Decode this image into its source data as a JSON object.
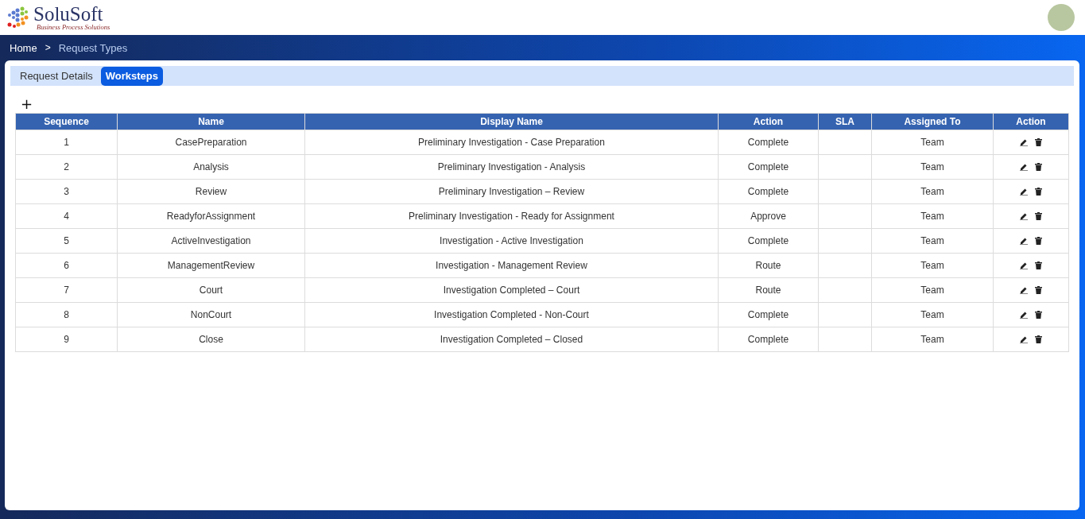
{
  "logo": {
    "name": "SoluSoft",
    "tagline": "Business Process Solutions"
  },
  "breadcrumb": [
    {
      "label": "Home",
      "current": false
    },
    {
      "label": "Request Types",
      "current": true
    }
  ],
  "breadcrumb_separator": ">",
  "tabs": [
    {
      "label": "Request Details",
      "selected": false
    },
    {
      "label": "Worksteps",
      "selected": true
    }
  ],
  "add_button": "+",
  "table": {
    "columns": [
      "Sequence",
      "Name",
      "Display Name",
      "Action",
      "SLA",
      "Assigned To",
      "Action"
    ],
    "rows": [
      {
        "sequence": "1",
        "name": "CasePreparation",
        "display_name": "Preliminary Investigation - Case Preparation",
        "action": "Complete",
        "assigned_to": "Team"
      },
      {
        "sequence": "2",
        "name": "Analysis",
        "display_name": "Preliminary Investigation - Analysis",
        "action": "Complete",
        "assigned_to": "Team"
      },
      {
        "sequence": "3",
        "name": "Review",
        "display_name": "Preliminary Investigation – Review",
        "action": "Complete",
        "assigned_to": "Team"
      },
      {
        "sequence": "4",
        "name": "ReadyforAssignment",
        "display_name": "Preliminary Investigation - Ready for Assignment",
        "action": "Approve",
        "assigned_to": "Team"
      },
      {
        "sequence": "5",
        "name": "ActiveInvestigation",
        "display_name": "Investigation - Active Investigation",
        "action": "Complete",
        "assigned_to": "Team"
      },
      {
        "sequence": "6",
        "name": "ManagementReview",
        "display_name": "Investigation - Management Review",
        "action": "Route",
        "assigned_to": "Team"
      },
      {
        "sequence": "7",
        "name": "Court",
        "display_name": "Investigation Completed – Court",
        "action": "Route",
        "assigned_to": "Team"
      },
      {
        "sequence": "8",
        "name": "NonCourt",
        "display_name": "Investigation Completed - Non-Court",
        "action": "Complete",
        "assigned_to": "Team"
      },
      {
        "sequence": "9",
        "name": "Close",
        "display_name": "Investigation Completed – Closed",
        "action": "Complete",
        "assigned_to": "Team"
      }
    ]
  }
}
